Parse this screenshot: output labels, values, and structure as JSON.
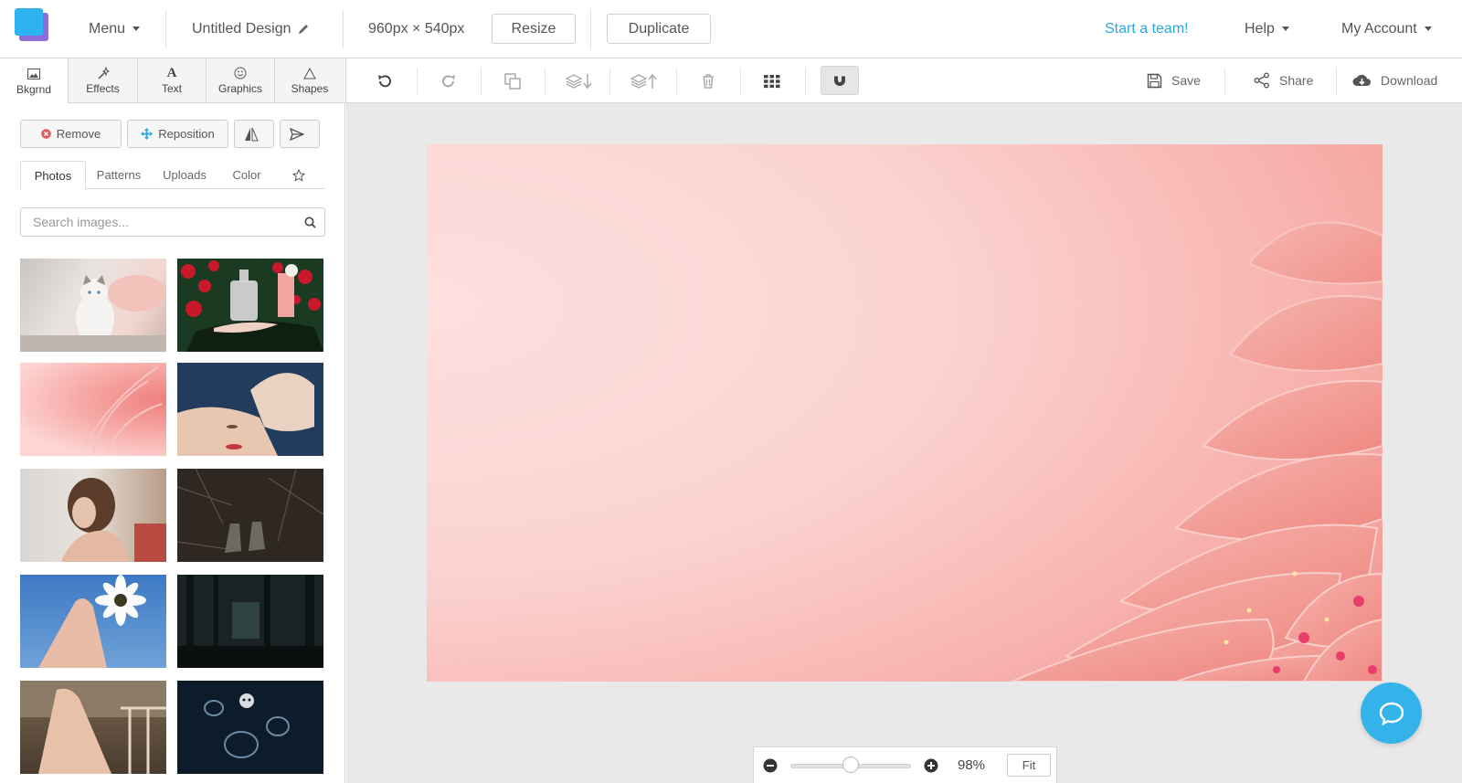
{
  "header": {
    "menu_label": "Menu",
    "design_title": "Untitled Design",
    "dimensions": "960px × 540px",
    "resize_label": "Resize",
    "duplicate_label": "Duplicate",
    "start_team_label": "Start a team!",
    "help_label": "Help",
    "account_label": "My Account",
    "colors": {
      "brand_blue": "#2cb3f0",
      "brand_purple": "#8f6cd9",
      "link": "#2ea7e0"
    }
  },
  "tool_tabs": [
    {
      "label": "Bkgrnd",
      "icon": "image-icon",
      "active": true
    },
    {
      "label": "Effects",
      "icon": "wand-icon",
      "active": false
    },
    {
      "label": "Text",
      "icon": "text-icon",
      "active": false
    },
    {
      "label": "Graphics",
      "icon": "smiley-icon",
      "active": false
    },
    {
      "label": "Shapes",
      "icon": "triangle-icon",
      "active": false
    }
  ],
  "toolbar": {
    "icons": [
      "undo-icon",
      "redo-icon",
      "copy-icon",
      "layer-down-icon",
      "layer-up-icon",
      "trash-icon",
      "grid-icon",
      "magnet-icon"
    ],
    "save_label": "Save",
    "share_label": "Share",
    "download_label": "Download"
  },
  "background_panel": {
    "remove_label": "Remove",
    "reposition_label": "Reposition",
    "tabs": [
      "Photos",
      "Patterns",
      "Uploads",
      "Color"
    ],
    "active_tab": "Photos",
    "search_placeholder": "Search images...",
    "thumbnails": [
      "cat-photo",
      "drink-bottle-photo",
      "pink-flower-photo",
      "woman-face-hand-photo",
      "woman-curly-hair-photo",
      "boots-in-forest-photo",
      "hand-with-daisy-photo",
      "dark-forest-photo",
      "woman-dress-dock-photo",
      "jellyfish-photo"
    ]
  },
  "zoom": {
    "value_label": "98%",
    "fit_label": "Fit",
    "level": 0.5
  },
  "chat": {
    "icon": "chat-bubble-icon",
    "color": "#33b3ea"
  }
}
